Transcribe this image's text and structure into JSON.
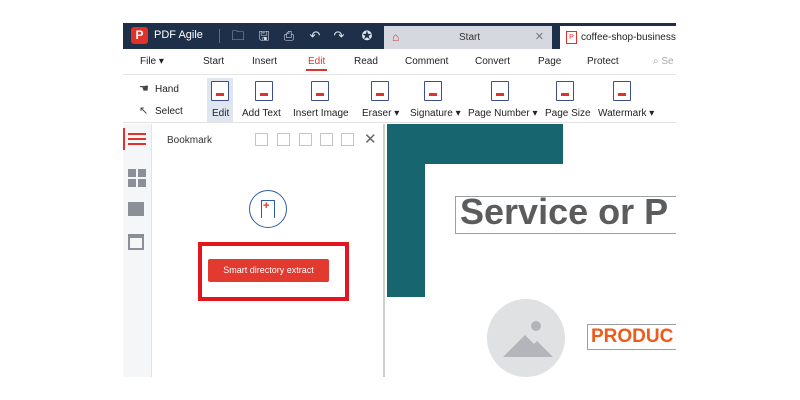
{
  "app": {
    "name": "PDF Agile",
    "logo_letter": "P"
  },
  "tabs": [
    {
      "label": "Start",
      "icon": "home-icon"
    },
    {
      "label": "coffee-shop-business-",
      "icon": "pdf-file-icon"
    }
  ],
  "quick_access": [
    "folder-icon",
    "save-icon",
    "print-icon",
    "undo-icon",
    "redo-icon",
    "star-icon"
  ],
  "menu": {
    "file": "File ▾",
    "items": [
      "Start",
      "Insert",
      "Edit",
      "Read",
      "Comment",
      "Convert",
      "Page",
      "Protect"
    ],
    "active": "Edit",
    "search_placeholder": "Se"
  },
  "toolbar": {
    "hand": "Hand",
    "select": "Select",
    "tools": [
      {
        "label": "Edit"
      },
      {
        "label": "Add Text"
      },
      {
        "label": "Insert Image"
      },
      {
        "label": "Eraser ▾"
      },
      {
        "label": "Signature ▾"
      },
      {
        "label": "Page Number ▾"
      },
      {
        "label": "Page Size"
      },
      {
        "label": "Watermark ▾"
      }
    ]
  },
  "panel": {
    "title": "Bookmark",
    "button": "Smart directory extract"
  },
  "document": {
    "heading": "Service or P",
    "subheading": "PRODUC"
  },
  "colors": {
    "accent": "#e0322b",
    "titlebar": "#1e2f4a",
    "teal": "#17666f",
    "highlight": "#e3151f"
  }
}
